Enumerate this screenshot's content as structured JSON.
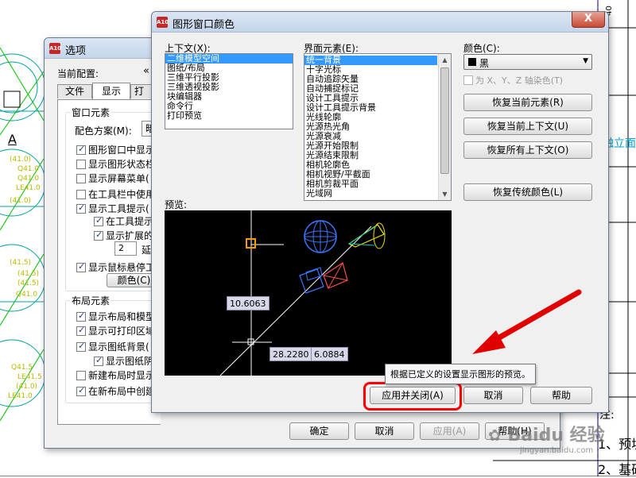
{
  "cad": {
    "left_marks": [
      "A",
      "(41.0)",
      "Q41.0",
      "Q41.0",
      "LE41.0",
      "(41.0)",
      "(41.5)",
      "(41.5)",
      "(41.5)",
      "Q41.0",
      "Q41.5",
      "LE41.5",
      "(41.0)",
      "LE41.0"
    ],
    "right_title": "融立面",
    "note_label": "注:",
    "note_1": "1、预埋",
    "note_2": "2、基础",
    "top_right_digits": "40",
    "watermark": "Baidu 经验",
    "watermark_url": "jingyan.baidu.com"
  },
  "options_window": {
    "title": "选项",
    "current_profile_label": "当前配置:",
    "tabs": [
      {
        "label": "文件"
      },
      {
        "label": "显示"
      },
      {
        "label": "打"
      }
    ],
    "window_elements": {
      "title": "窗口元素",
      "color_scheme_label": "配色方案(M):",
      "color_scheme_value": "暗",
      "options": [
        {
          "label": "图形窗口中显示",
          "checked": true
        },
        {
          "label": "显示图形状态栏",
          "checked": false
        },
        {
          "label": "显示屏幕菜单(",
          "checked": false
        },
        {
          "label": "在工具栏中使用",
          "checked": false
        },
        {
          "label": "显示工具提示(",
          "checked": true
        },
        {
          "label": "在工具提示",
          "checked": true
        },
        {
          "label": "显示扩展的",
          "checked": true
        }
      ],
      "delay_value": "2",
      "delay_label": "延",
      "hover_option": {
        "label": "显示鼠标悬停工",
        "checked": true
      },
      "colors_button": "颜色(C)"
    },
    "layout_elements": {
      "title": "布局元素",
      "options": [
        {
          "label": "显示布局和模型",
          "checked": true
        },
        {
          "label": "显示可打印区域",
          "checked": true
        },
        {
          "label": "显示图纸背景(",
          "checked": true
        },
        {
          "label": "显示图纸阴",
          "checked": true
        },
        {
          "label": "新建布局时显示",
          "checked": false
        },
        {
          "label": "在新布局中创建",
          "checked": true
        }
      ]
    },
    "buttons": {
      "ok": "确定",
      "cancel": "取消",
      "apply": "应用(A)",
      "help": "帮助(H)"
    }
  },
  "color_dialog": {
    "title": "图形窗口颜色",
    "close_glyph": "X",
    "context_label": "上下文(X):",
    "context_items": [
      {
        "label": "二维模型空间",
        "selected": true
      },
      {
        "label": "图纸/布局",
        "selected": false
      },
      {
        "label": "三维平行投影",
        "selected": false
      },
      {
        "label": "三维透视投影",
        "selected": false
      },
      {
        "label": "块编辑器",
        "selected": false
      },
      {
        "label": "命令行",
        "selected": false
      },
      {
        "label": "打印预览",
        "selected": false
      }
    ],
    "interface_label": "界面元素(E):",
    "interface_items": [
      {
        "label": "统一背景",
        "selected": true
      },
      {
        "label": "十字光标",
        "selected": false
      },
      {
        "label": "自动追踪矢量",
        "selected": false
      },
      {
        "label": "自动捕捉标记",
        "selected": false
      },
      {
        "label": "设计工具提示",
        "selected": false
      },
      {
        "label": "设计工具提示背景",
        "selected": false
      },
      {
        "label": "光线轮廓",
        "selected": false
      },
      {
        "label": "光源热光角",
        "selected": false
      },
      {
        "label": "光源衰减",
        "selected": false
      },
      {
        "label": "光源开始限制",
        "selected": false
      },
      {
        "label": "光源结束限制",
        "selected": false
      },
      {
        "label": "相机轮廓色",
        "selected": false
      },
      {
        "label": "相机视野/平截面",
        "selected": false
      },
      {
        "label": "相机剪裁平面",
        "selected": false
      },
      {
        "label": "光域网",
        "selected": false
      }
    ],
    "color_label": "颜色(C):",
    "color_value": "黑",
    "color_swatch": "#000000",
    "tint_checkbox_label": "为 X、Y、Z 轴染色(T)",
    "buttons": {
      "restore_element": "恢复当前元素(R)",
      "restore_context": "恢复当前上下文(U)",
      "restore_all": "恢复所有上下文(O)",
      "restore_classic": "恢复传统颜色(L)",
      "apply_close": "应用并关闭(A)",
      "cancel": "取消",
      "help": "帮助"
    },
    "preview_label": "预览:",
    "preview": {
      "dim_1": "10.6063",
      "dim_2": "28.2280",
      "dim_3": "6.0884"
    },
    "tooltip": "根据已定义的设置显示图形的预览。",
    "colors": {
      "highlight": "#ff0000",
      "accent_list": "#3399ff"
    }
  }
}
